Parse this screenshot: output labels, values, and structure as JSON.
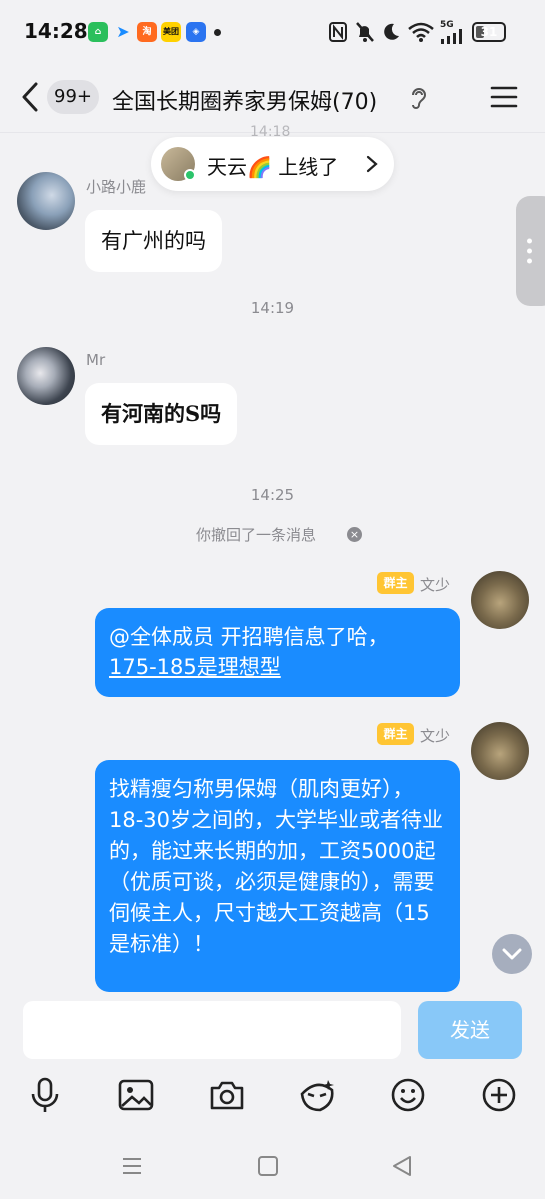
{
  "status_bar": {
    "time": "14:28",
    "app_icons": [
      "mi-home-icon",
      "play-arrow-icon",
      "taobao-icon",
      "meituan-icon",
      "security-shield-icon"
    ],
    "meituan_label": "美团",
    "signal": "5G",
    "battery": "31",
    "battery_level": 0.31
  },
  "header": {
    "unread_count": "99+",
    "title": "全国长期圈养家男保姆(70)"
  },
  "online_toast": {
    "text": "天云🌈 上线了"
  },
  "hidden_timestamp": "14:18",
  "messages": [
    {
      "sender": "小路小鹿",
      "text": "有广州的吗"
    },
    {
      "timestamp": "14:19"
    },
    {
      "sender": "Mr",
      "text": "有河南的S吗"
    },
    {
      "timestamp": "14:25"
    },
    {
      "system": "你撤回了一条消息"
    },
    {
      "sender": "文少",
      "badge": "群主",
      "line1": "@全体成员 开招聘信息了哈，",
      "line2": "175-185是理想型"
    },
    {
      "sender": "文少",
      "badge": "群主",
      "text": "找精瘦匀称男保姆（肌肉更好），18-30岁之间的，大学毕业或者待业的，能过来长期的加，工资5000起（优质可谈，必须是健康的），需要伺候主人，尺寸越大工资越高（15是标准）！"
    }
  ],
  "input": {
    "placeholder": "",
    "send_label": "发送"
  },
  "toolbar": [
    "microphone-icon",
    "image-icon",
    "camera-icon",
    "sticker-face-icon",
    "emoji-icon",
    "plus-icon"
  ],
  "colors": {
    "bubble_out": "#1a8cff",
    "send_disabled": "#88c8f8",
    "owner_badge": "#ffc533",
    "background": "#f2f2f4"
  }
}
